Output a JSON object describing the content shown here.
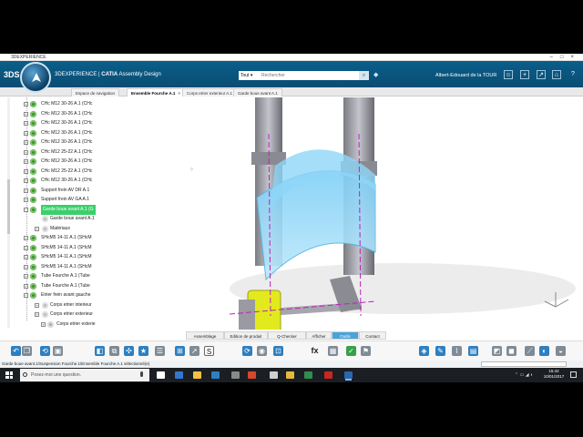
{
  "window": {
    "title": "3DEXPERIENCE",
    "controls": [
      "–",
      "□",
      "×"
    ]
  },
  "header": {
    "brand_logo": "3DS",
    "brand": "3DEXPERIENCE",
    "separator": " | ",
    "app_name_bold": "CATIA",
    "app_name": " Assembly Design",
    "search_scope": "Tout ▾",
    "search_placeholder": "Rechercher",
    "search_icon": "search-icon",
    "user_name": "Albert-Edouard de la TOUR",
    "icons": [
      "user-icon",
      "plus-icon",
      "share-icon",
      "home-icon",
      "help-icon"
    ]
  },
  "tabs": [
    {
      "label": "Espace de navigation",
      "active": false
    },
    {
      "label": "Ensemble Fourche A.1",
      "active": true,
      "close": "×"
    },
    {
      "label": "Corps etrier exterieur A.1",
      "active": false
    },
    {
      "label": "Garde boue avant A.1",
      "active": false
    }
  ],
  "tree": {
    "items": [
      {
        "label": "CHc M12 30-26 A.1 (CHc",
        "expander": "+",
        "indent": 0
      },
      {
        "label": "CHc M12 30-26 A.1 (CHc",
        "expander": "+",
        "indent": 0
      },
      {
        "label": "CHc M12 30-26 A.1 (CHc",
        "expander": "+",
        "indent": 0
      },
      {
        "label": "CHc M12 30-26 A.1 (CHc",
        "expander": "+",
        "indent": 0
      },
      {
        "label": "CHc M12 30-26 A.1 (CHc",
        "expander": "+",
        "indent": 0
      },
      {
        "label": "CHc M12 25-22 A.1 (CHc",
        "expander": "+",
        "indent": 0
      },
      {
        "label": "CHc M12 30-26 A.1 (CHc",
        "expander": "+",
        "indent": 0
      },
      {
        "label": "CHc M12 25-22 A.1 (CHc",
        "expander": "+",
        "indent": 0
      },
      {
        "label": "CHc M12 30-26 A.1 (CHc",
        "expander": "+",
        "indent": 0
      },
      {
        "label": "Support frein AV DR A.1",
        "expander": "+",
        "indent": 0
      },
      {
        "label": "Support frein AV GA A.1",
        "expander": "+",
        "indent": 0
      },
      {
        "label": "Garde boue avant A.1 (G",
        "expander": "−",
        "indent": 0,
        "selected": true
      },
      {
        "label": "Garde boue avant A.1",
        "expander": "",
        "indent": 1
      },
      {
        "label": "Matériaux",
        "expander": "+",
        "indent": 1
      },
      {
        "label": "SHcM5 14-11 A.1 (SHcM",
        "expander": "+",
        "indent": 0
      },
      {
        "label": "SHcM5 14-11 A.1 (SHcM",
        "expander": "+",
        "indent": 0
      },
      {
        "label": "SHcM5 14-11 A.1 (SHcM",
        "expander": "+",
        "indent": 0
      },
      {
        "label": "SHcM5 14-11 A.1 (SHcM",
        "expander": "+",
        "indent": 0
      },
      {
        "label": "Tube Fourche A.1 (Tube",
        "expander": "+",
        "indent": 0
      },
      {
        "label": "Tube Fourche A.1 (Tube",
        "expander": "+",
        "indent": 0
      },
      {
        "label": "Etrier frein avant gauche",
        "expander": "−",
        "indent": 0
      },
      {
        "label": "Corps etrier interieur",
        "expander": "+",
        "indent": 1
      },
      {
        "label": "Corps etrier exterieur",
        "expander": "+",
        "indent": 1
      },
      {
        "label": "Corps etrier exterie",
        "expander": "+",
        "indent": 2
      }
    ]
  },
  "viewport": {
    "cursor_mark": "⁘"
  },
  "section_tabs": [
    {
      "label": "Assemblage",
      "active": false
    },
    {
      "label": "Edition de produit",
      "active": false
    },
    {
      "label": "Q-Checker",
      "active": false
    },
    {
      "label": "Afficher",
      "active": false
    },
    {
      "label": "Outils",
      "active": true
    },
    {
      "label": "Contact",
      "active": false
    }
  ],
  "actionbar": {
    "tools": [
      {
        "icon": "undo-icon",
        "glyph": "↶",
        "style": "blue"
      },
      {
        "icon": "copy-icon",
        "glyph": "❐",
        "style": "grey"
      },
      {
        "icon": "refresh-icon",
        "glyph": "⟲",
        "style": "blue"
      },
      {
        "icon": "car-icon",
        "glyph": "▣",
        "style": "grey"
      },
      {
        "icon": "assembly-icon",
        "glyph": "◧",
        "style": "blue"
      },
      {
        "icon": "mate-icon",
        "glyph": "⧉",
        "style": "grey"
      },
      {
        "icon": "explode-icon",
        "glyph": "✣",
        "style": "blue"
      },
      {
        "icon": "star-icon",
        "glyph": "★",
        "style": "blue"
      },
      {
        "icon": "list-icon",
        "glyph": "☰",
        "style": "grey"
      },
      {
        "icon": "measure-icon",
        "glyph": "⊞",
        "style": "blue"
      },
      {
        "icon": "pointer-icon",
        "glyph": "➚",
        "style": "grey"
      },
      {
        "icon": "s-tool-icon",
        "glyph": "S",
        "style": "sq"
      },
      {
        "icon": "update-icon",
        "glyph": "⟳",
        "style": "blue"
      },
      {
        "icon": "camera-icon",
        "glyph": "◉",
        "style": "grey"
      },
      {
        "icon": "param-icon",
        "glyph": "⊡",
        "style": "blue"
      },
      {
        "icon": "formula-icon",
        "glyph": "fx",
        "style": "txt"
      },
      {
        "icon": "table-icon",
        "glyph": "▦",
        "style": "grey"
      },
      {
        "icon": "check-icon",
        "glyph": "✓",
        "style": "green"
      },
      {
        "icon": "rule-icon",
        "glyph": "⚑",
        "style": "grey"
      },
      {
        "icon": "render-icon",
        "glyph": "◈",
        "style": "blue"
      },
      {
        "icon": "pen-icon",
        "glyph": "✎",
        "style": "blue"
      },
      {
        "icon": "brush-icon",
        "glyph": "⌇",
        "style": "grey"
      },
      {
        "icon": "sheet-icon",
        "glyph": "▤",
        "style": "blue"
      },
      {
        "icon": "section-icon",
        "glyph": "◩",
        "style": "grey"
      },
      {
        "icon": "cube-icon",
        "glyph": "◼",
        "style": "grey"
      },
      {
        "icon": "ruler-icon",
        "glyph": "⟋",
        "style": "grey"
      },
      {
        "icon": "material-icon",
        "glyph": "◐",
        "style": "blue"
      },
      {
        "icon": "view-icon",
        "glyph": "◒",
        "style": "grey"
      }
    ]
  },
  "status": {
    "text": "Garde boue avant.1/Suspension Fourche.1/Ensemble Fourche A.1 sélectionné(e)"
  },
  "taskbar": {
    "search_placeholder": "Posez-moi une question.",
    "apps": [
      {
        "icon": "task-view-icon",
        "color": "#ffffff"
      },
      {
        "icon": "edge-icon",
        "color": "#3277d2"
      },
      {
        "icon": "explorer-icon",
        "color": "#f5c342"
      },
      {
        "icon": "store-icon",
        "color": "#2d7fc1"
      },
      {
        "icon": "calculator-icon",
        "color": "#8a8a8a"
      },
      {
        "icon": "office-icon",
        "color": "#d7472b"
      },
      {
        "icon": "media-icon",
        "color": "#cfcfcf"
      },
      {
        "icon": "chrome-icon",
        "color": "#e6b93b"
      },
      {
        "icon": "excel-icon",
        "color": "#2f8f4e"
      },
      {
        "icon": "acrobat-icon",
        "color": "#c8281f"
      },
      {
        "icon": "catia-icon",
        "color": "#2b66b0"
      }
    ],
    "tray_icons": "⌃ ▭ ◢ ◖",
    "time": "15:42",
    "date": "10/01/2017"
  }
}
